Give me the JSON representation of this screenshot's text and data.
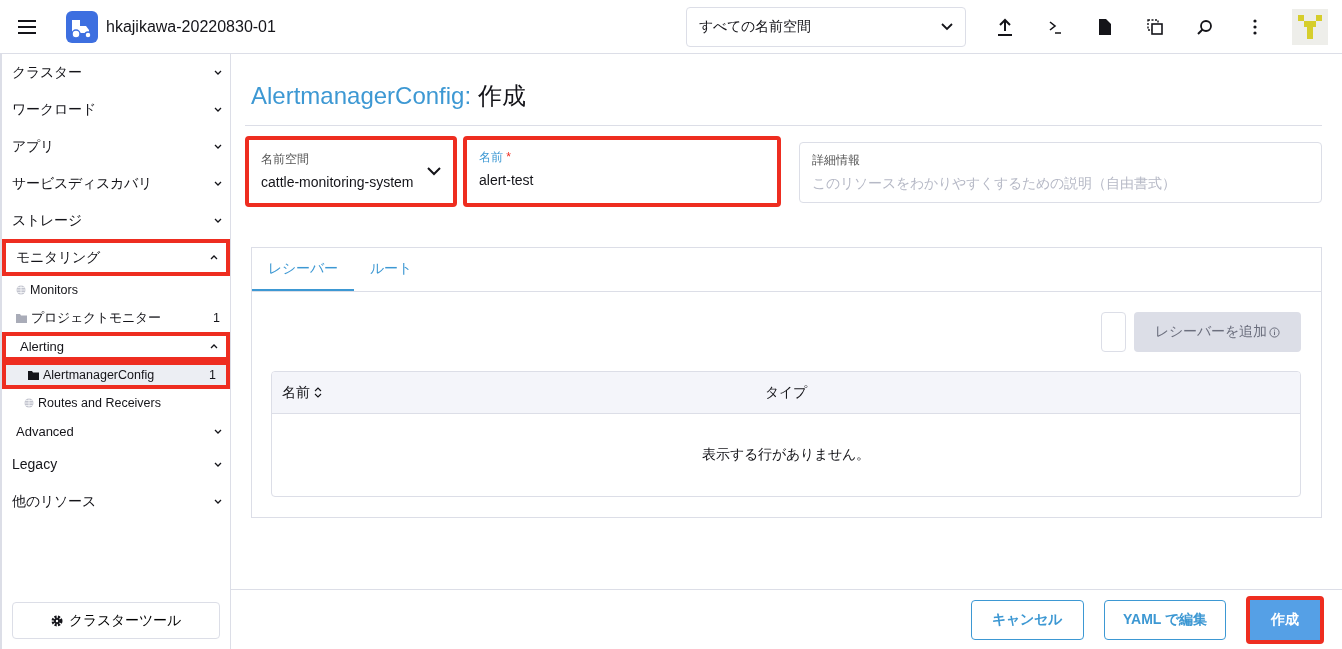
{
  "header": {
    "cluster_name": "hkajikawa-20220830-01",
    "namespace_select": "すべての名前空間"
  },
  "sidebar": {
    "items": [
      {
        "kind": "group",
        "label": "クラスター",
        "expanded": false,
        "highlighted": false
      },
      {
        "kind": "group",
        "label": "ワークロード",
        "expanded": false,
        "highlighted": false
      },
      {
        "kind": "group",
        "label": "アプリ",
        "expanded": false,
        "highlighted": false
      },
      {
        "kind": "group",
        "label": "サービスディスカバリ",
        "expanded": false,
        "highlighted": false
      },
      {
        "kind": "group",
        "label": "ストレージ",
        "expanded": false,
        "highlighted": false
      },
      {
        "kind": "group",
        "label": "モニタリング",
        "expanded": true,
        "highlighted": true,
        "children": [
          {
            "kind": "globe",
            "label": "Monitors",
            "selected": false,
            "highlighted": false
          },
          {
            "kind": "folder",
            "label": "プロジェクトモニター",
            "count": "1",
            "selected": false,
            "highlighted": false
          },
          {
            "kind": "group",
            "label": "Alerting",
            "expanded": true,
            "highlighted": true,
            "children": [
              {
                "kind": "folder",
                "label": "AlertmanagerConfig",
                "count": "1",
                "selected": true,
                "highlighted": true
              },
              {
                "kind": "globe",
                "label": "Routes and Receivers",
                "selected": false,
                "highlighted": false
              }
            ]
          },
          {
            "kind": "group",
            "label": "Advanced",
            "expanded": false,
            "highlighted": false
          }
        ]
      },
      {
        "kind": "group",
        "label": "Legacy",
        "expanded": false,
        "highlighted": false
      },
      {
        "kind": "group",
        "label": "他のリソース",
        "expanded": false,
        "highlighted": false
      }
    ],
    "footer_button": "クラスターツール"
  },
  "page": {
    "title_kind": "AlertmanagerConfig:",
    "title_action": "作成"
  },
  "form": {
    "namespace": {
      "label": "名前空間",
      "value": "cattle-monitoring-system",
      "highlighted": true
    },
    "name": {
      "label": "名前",
      "required_mark": "*",
      "value": "alert-test",
      "highlighted": true
    },
    "description": {
      "label": "詳細情報",
      "placeholder": "このリソースをわかりやすくするための説明（自由書式）"
    }
  },
  "tabs": [
    {
      "label": "レシーバー",
      "selected": true
    },
    {
      "label": "ルート",
      "selected": false
    }
  ],
  "receivers": {
    "add_button": {
      "label": "レシーバーを追加",
      "disabled": true
    },
    "table": {
      "columns": [
        {
          "label": "名前",
          "sortable": true
        },
        {
          "label": "タイプ",
          "sortable": false
        }
      ],
      "empty_message": "表示する行がありません。"
    }
  },
  "actions": [
    {
      "kind": "outline",
      "label": "キャンセル",
      "highlighted": false
    },
    {
      "kind": "outline",
      "label": "YAML で編集",
      "highlighted": false
    },
    {
      "kind": "primary",
      "label": "作成",
      "highlighted": true
    }
  ]
}
